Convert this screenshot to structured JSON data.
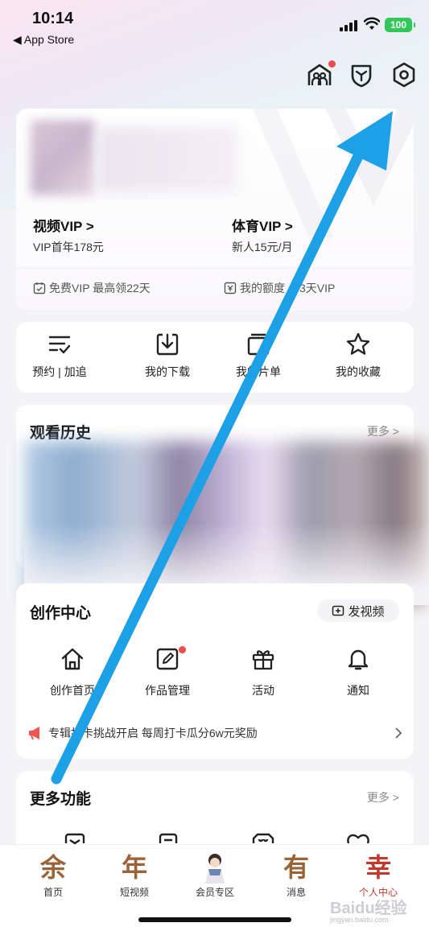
{
  "status_bar": {
    "time": "10:14",
    "back_app": "◀ App Store",
    "battery": "100"
  },
  "colors": {
    "accent_blue": "#1ea0e6",
    "brand_brown": "#9a6438",
    "active_red": "#c0392b",
    "dot_red": "#f04b4b"
  },
  "top_icons": [
    "family-icon",
    "shield-icon",
    "settings-icon"
  ],
  "vip": {
    "video_title": "视频VIP >",
    "video_sub": "VIP首年178元",
    "sports_title": "体育VIP >",
    "sports_sub": "新人15元/月",
    "free_vip": "免费VIP 最高领22天",
    "my_quota": "我的额度",
    "quota_days": "3天VIP"
  },
  "quick_actions": [
    {
      "label": "预约 | 加追",
      "icon": "list-check-icon"
    },
    {
      "label": "我的下载",
      "icon": "download-icon"
    },
    {
      "label": "我的片单",
      "icon": "playlist-icon"
    },
    {
      "label": "我的收藏",
      "icon": "star-icon"
    }
  ],
  "history": {
    "title": "观看历史",
    "more": "更多 >"
  },
  "create_center": {
    "title": "创作中心",
    "post_video": "发视频",
    "actions": [
      {
        "label": "创作首页",
        "icon": "home-icon"
      },
      {
        "label": "作品管理",
        "icon": "edit-icon"
      },
      {
        "label": "活动",
        "icon": "gift-icon"
      },
      {
        "label": "通知",
        "icon": "bell-icon"
      }
    ],
    "notice": "专辑打卡挑战开启 每周打卡瓜分6w元奖励"
  },
  "more_features": {
    "title": "更多功能",
    "more": "更多 >"
  },
  "tabs": [
    {
      "glyph": "余",
      "label": "首页"
    },
    {
      "glyph": "年",
      "label": "短视频"
    },
    {
      "glyph": "",
      "label": "会员专区"
    },
    {
      "glyph": "有",
      "label": "消息"
    },
    {
      "glyph": "幸",
      "label": "个人中心"
    }
  ],
  "watermark": {
    "main": "Baidu经验",
    "sub": "jingyan.baidu.com"
  }
}
